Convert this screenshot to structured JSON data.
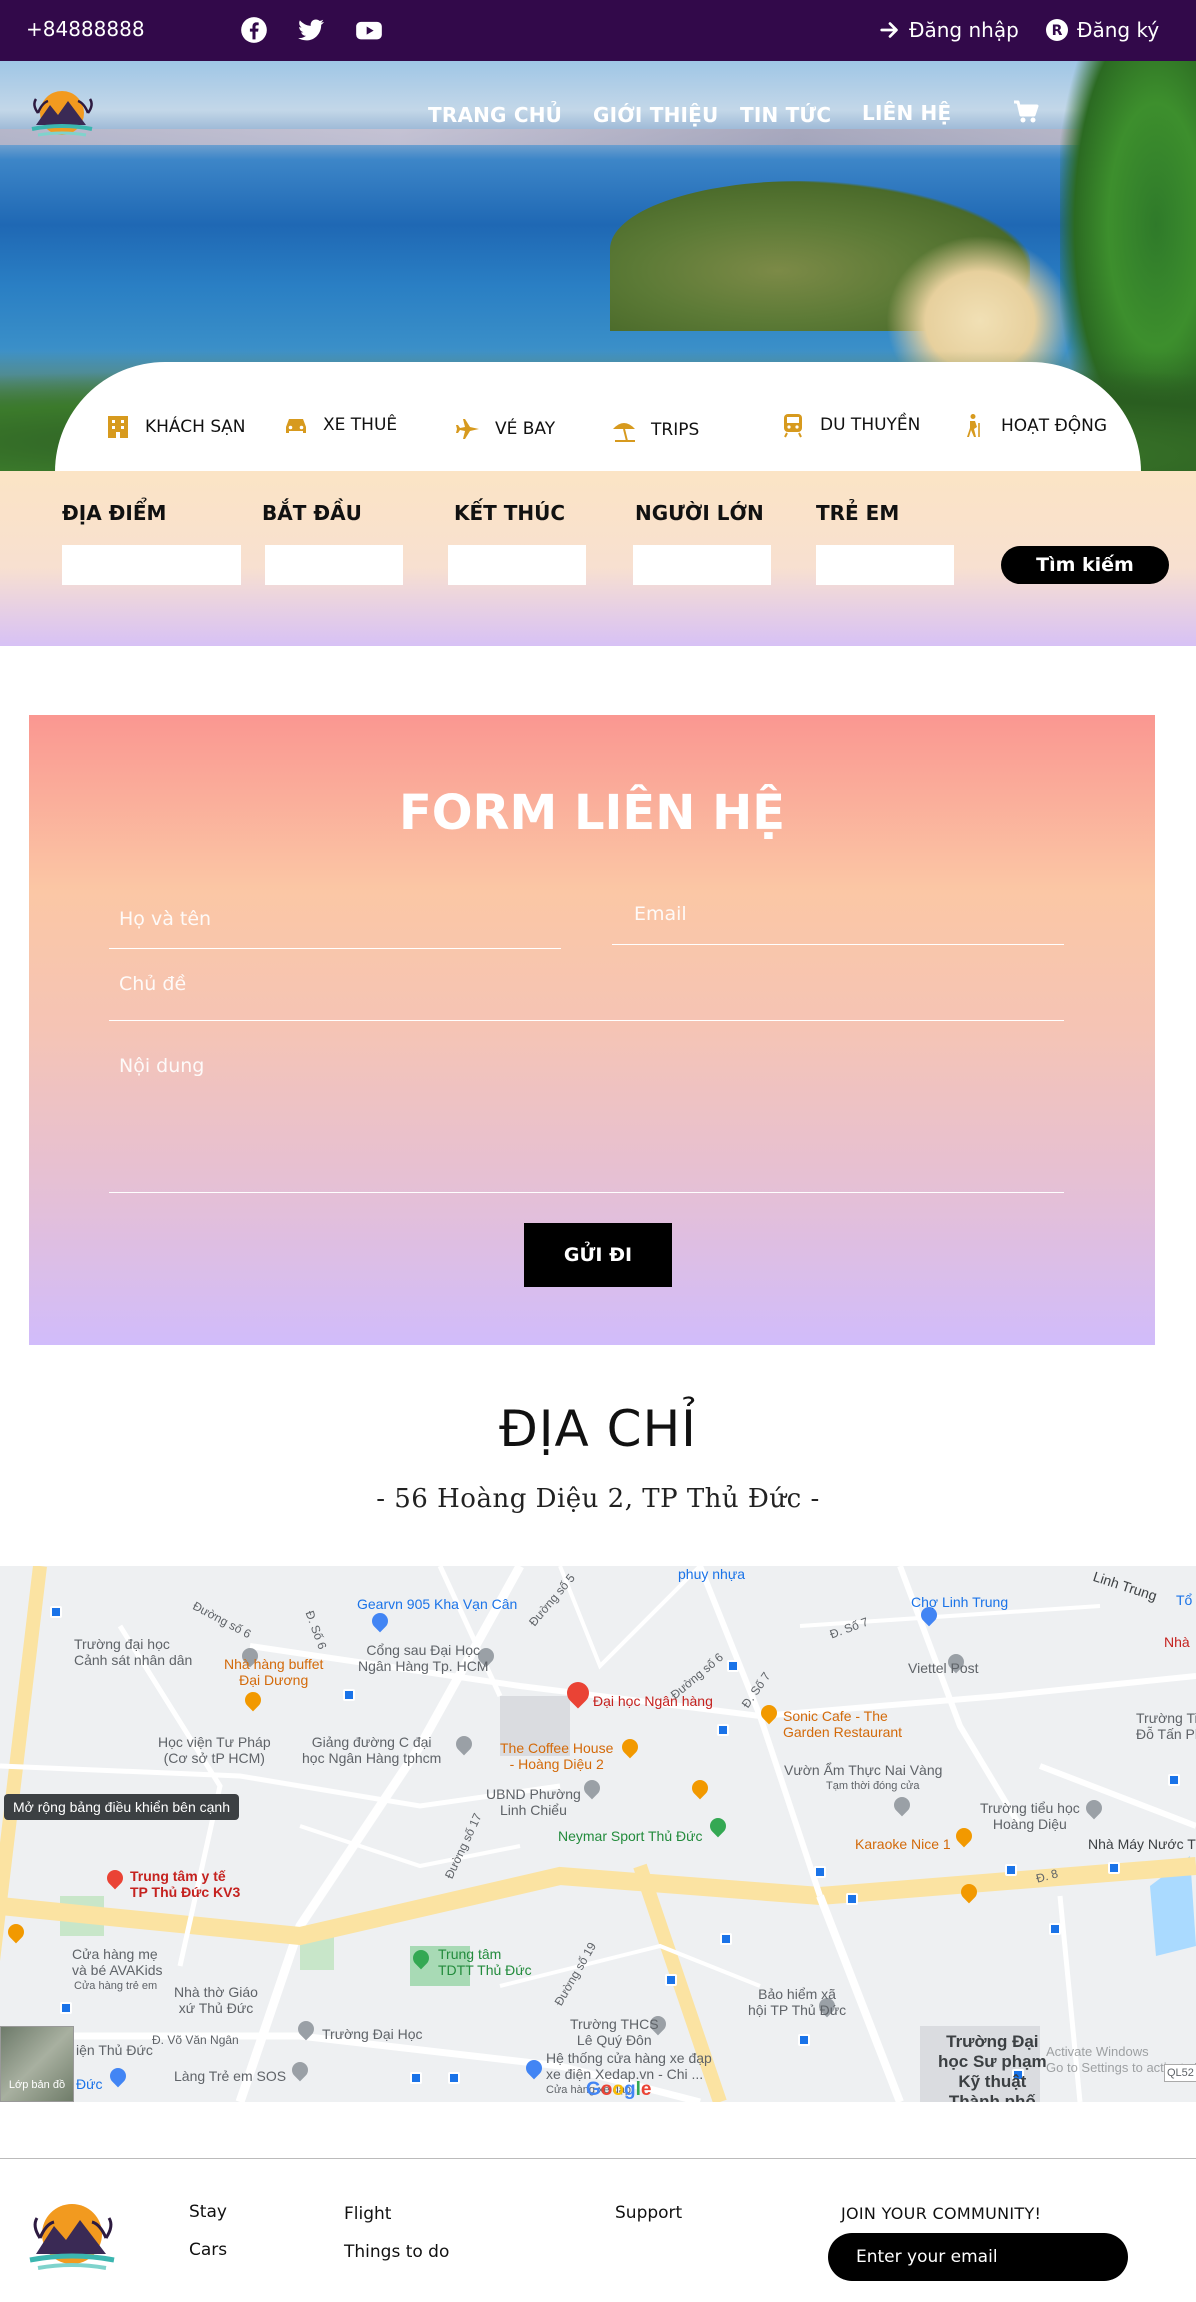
{
  "topbar": {
    "phone": "+84888888",
    "social": [
      "facebook-icon",
      "twitter-icon",
      "youtube-icon"
    ],
    "login_label": "Đăng nhập",
    "register_label": "Đăng ký"
  },
  "nav": {
    "items": [
      "TRANG CHỦ",
      "GIỚI THIỆU",
      "TIN TỨC",
      "LIÊN HỆ"
    ],
    "cart_icon": "cart-icon"
  },
  "categories": [
    {
      "label": "KHÁCH SẠN",
      "icon": "hotel-icon"
    },
    {
      "label": "XE THUÊ",
      "icon": "car-icon"
    },
    {
      "label": "VÉ BAY",
      "icon": "plane-icon"
    },
    {
      "label": "TRIPS",
      "icon": "beach-umbrella-icon"
    },
    {
      "label": "DU THUYỀN",
      "icon": "train-icon"
    },
    {
      "label": "HOẠT ĐỘNG",
      "icon": "hiking-icon"
    }
  ],
  "search": {
    "labels": [
      "ĐỊA ĐIỂM",
      "BẮT ĐẦU",
      "KẾT THÚC",
      "NGƯỜI LỚN",
      "TRẺ EM"
    ],
    "button": "Tìm kiếm"
  },
  "contact": {
    "title": "FORM LIÊN HỆ",
    "name_placeholder": "Họ và tên",
    "email_placeholder": "Email",
    "subject_placeholder": "Chủ đề",
    "message_placeholder": "Nội dung",
    "submit": "GỬI ĐI"
  },
  "address": {
    "title": "ĐỊA CHỈ",
    "line": "- 56 Hoàng Diệu 2, TP Thủ Đức -"
  },
  "map": {
    "tooltip": "Mở rộng bảng điều khiển bên cạnh",
    "layer_label": "Lớp bản đồ",
    "google": "Google",
    "labels": {
      "phuy_nhua": "phuy nhựa",
      "gearvn": "Gearvn 905 Kha Vạn Cân",
      "cho_linh_trung": "Chợ Linh Trung",
      "linh_trung": "Linh Trung",
      "truong_canh_sat": "Trường đại học\nCảnh sát nhân dân",
      "buffet": "Nhà hàng buffet\nĐại Dương",
      "cong_sau": "Cổng sau Đại Học\nNgân Hàng Tp. HCM",
      "dh_ngan_hang": "Đại học Ngân hàng",
      "viettel": "Viettel Post",
      "sonic": "Sonic Cafe - The\nGarden Restaurant",
      "tieu_hoc_dtp": "Trường Tiểu Họ\nĐỗ Tấn Phon",
      "hoc_vien": "Học viện Tư Pháp\n(Cơ sở tP HCM)",
      "giang_duong": "Giảng đường C đại\nhọc Ngân Hàng tphcm",
      "coffee_house": "The Coffee House\n- Hoàng Diệu 2",
      "vuon_am_thuc": "Vườn Ẩm Thực Nai Vàng",
      "tam_thoi": "Tạm thời đóng cửa",
      "ubnd": "UBND Phường\nLinh Chiểu",
      "neymar": "Neymar Sport Thủ Đức",
      "karaoke": "Karaoke Nice 1",
      "tieu_hoc_hd": "Trường tiểu học\nHoàng Diệu",
      "nha_may_nuoc": "Nhà Máy Nước T",
      "trung_tam_yte": "Trung tâm y tế\nTP Thủ Đức KV3",
      "cua_hang_me": "Cửa hàng mẹ\nvà bé AVAKids",
      "cua_hang_tre_em": "Cửa hàng trẻ em",
      "tdtt": "Trung tâm\nTDTT Thủ Đức",
      "nha_tho": "Nhà thờ Giáo\nxứ Thủ Đức",
      "bao_hiem": "Bảo hiểm xã\nhội TP Thủ Đức",
      "truong_dai_hoc": "Trường Đại Học",
      "thcs_lqd": "Trường THCS\nLê Quý Đôn",
      "xedap": "Hệ thống cửa hàng xe đạp\nxe điện Xedap.vn - Chi ...",
      "cua_hang_xe": "Cửa hàng xe đạp",
      "lang_tre": "Làng Trẻ em SOS",
      "dh_su_pham": "Trường Đại\nhọc Sư phạm\nKỹ thuật\nThành phố",
      "windows_watermark": "Activate Windows\nGo to Settings to activate Windows.",
      "duong_so_5": "Đường số 5",
      "duong_so_6": "Đường số 6",
      "d_so_6": "Đ. Số 6",
      "d_so_7": "Đ. Số 7",
      "d_vo_van_ngan": "Đ. Võ Văn Ngân",
      "duong_so_17": "Đường số 17",
      "duong_so_19": "Đường số 19",
      "d_8": "Đ. 8",
      "ql52": "QL52",
      "to": "Tổ",
      "nha": "Nhà",
      "duc": "Đức",
      "thu_duc_left": "iện Thủ Đức"
    }
  },
  "footer": {
    "col1": [
      "Stay",
      "Cars"
    ],
    "col2": [
      "Flight",
      "Things to do"
    ],
    "col3": [
      "Support"
    ],
    "join": "JOIN YOUR COMMUNITY!",
    "email_placeholder": "Enter your email"
  }
}
